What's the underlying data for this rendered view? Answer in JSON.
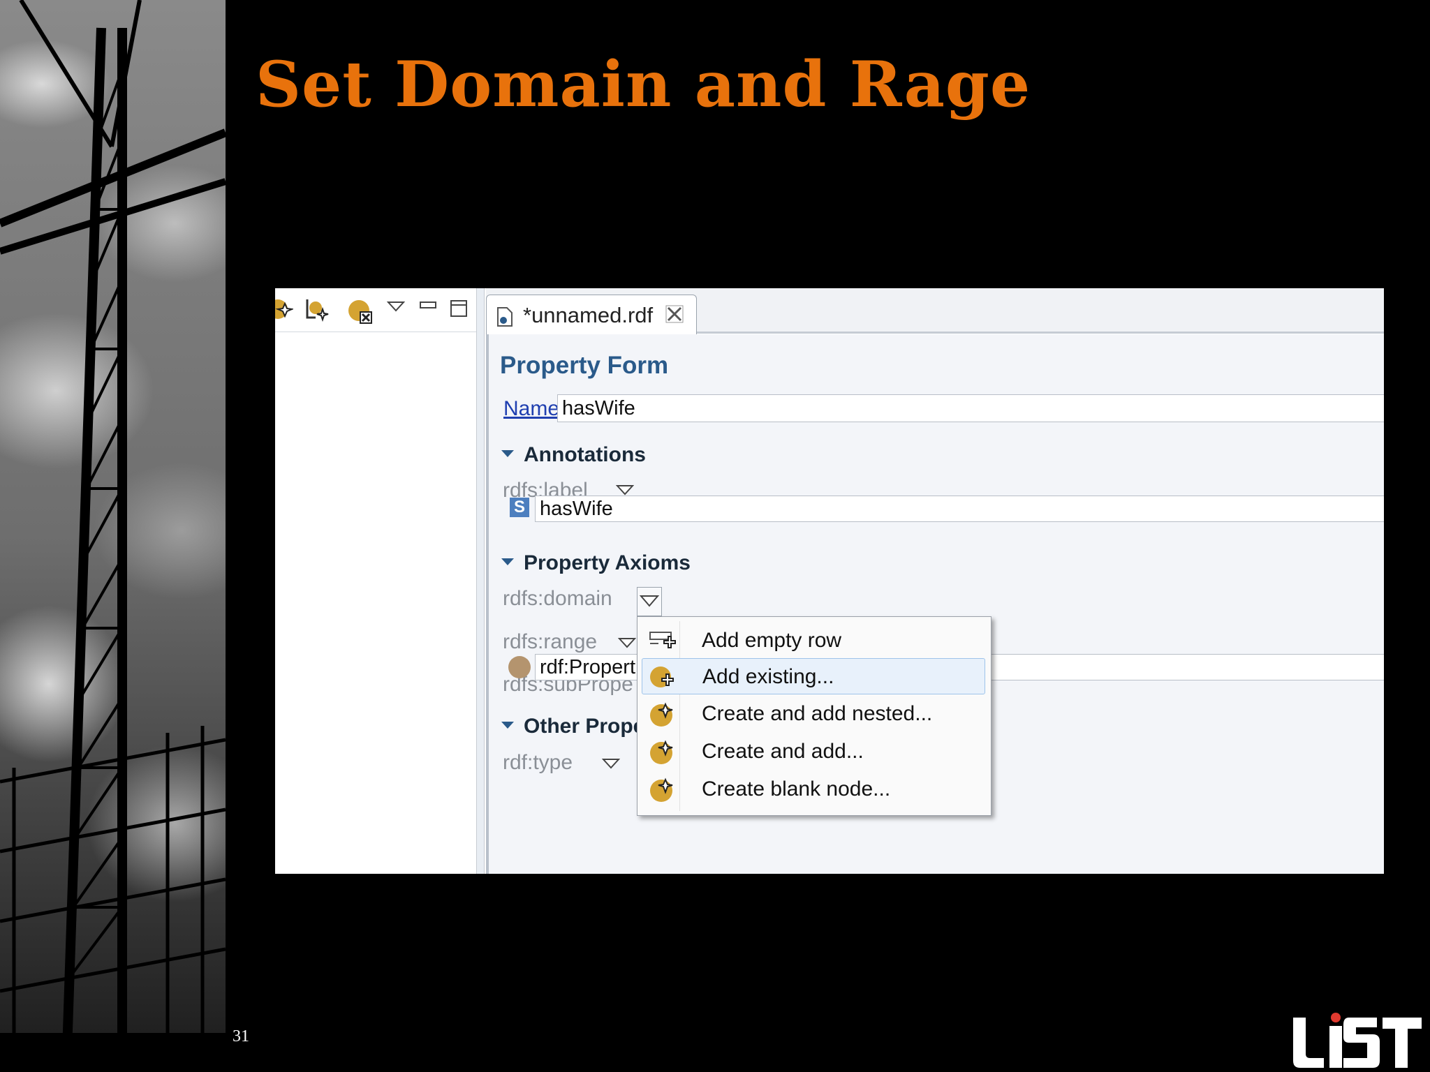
{
  "slide": {
    "title": "Set Domain and Rage",
    "page_number": "31",
    "logo_text": "UST"
  },
  "editor": {
    "tab_label": "*unnamed.rdf",
    "form_title": "Property Form",
    "name_label": "Name:",
    "name_value": "hasWife",
    "sections": {
      "annotations": "Annotations",
      "property_axioms": "Property Axioms",
      "other_properties": "Other Prope"
    },
    "props": {
      "label": "rdfs:label",
      "label_value": "hasWife",
      "label_badge": "S",
      "domain": "rdfs:domain",
      "range": "rdfs:range",
      "subproperty": "rdfs:subPrope",
      "type": "rdf:type",
      "type_value": "rdf:Propert"
    }
  },
  "context_menu": {
    "items": [
      {
        "label": "Add empty row",
        "icon": "add-row-icon"
      },
      {
        "label": "Add existing...",
        "icon": "add-existing-icon",
        "selected": true
      },
      {
        "label": "Create and add nested...",
        "icon": "create-nested-icon"
      },
      {
        "label": "Create and add...",
        "icon": "create-add-icon"
      },
      {
        "label": "Create blank node...",
        "icon": "blank-node-icon"
      }
    ]
  },
  "colors": {
    "title": "#E8720C",
    "form_title": "#2a5a8a",
    "link": "#1f3fb0",
    "menu_highlight": "#e8f1fb",
    "resource_dot": "#b4946e"
  }
}
